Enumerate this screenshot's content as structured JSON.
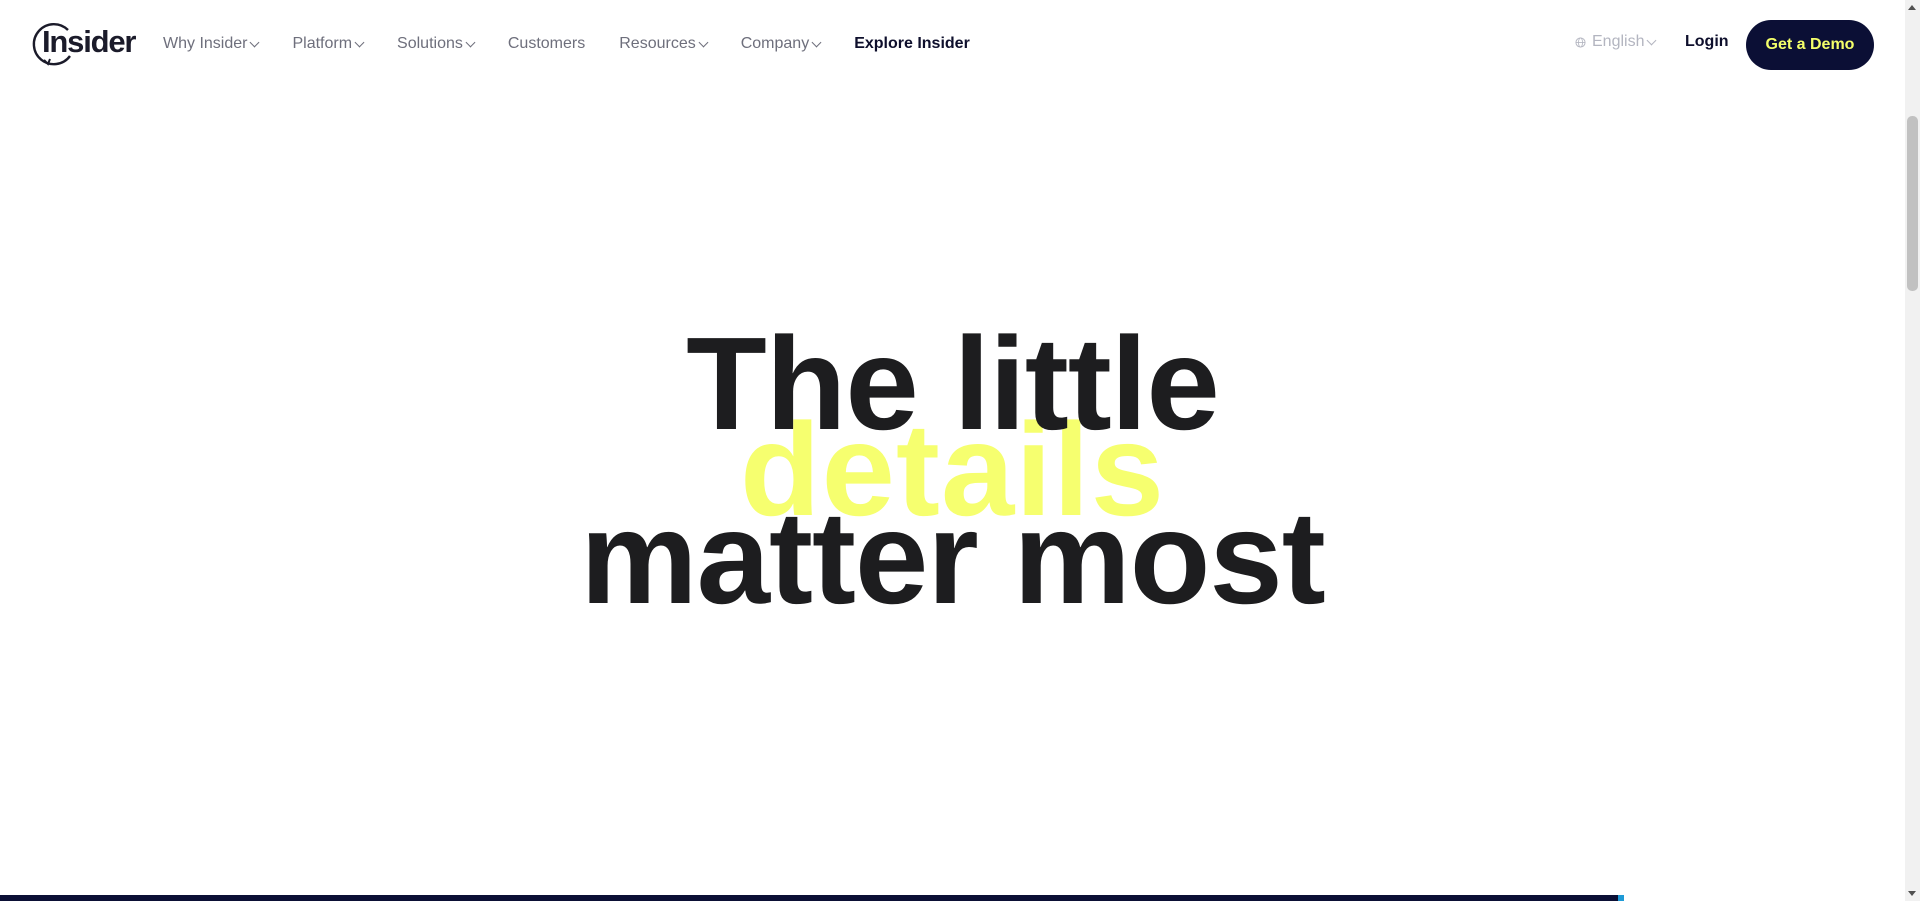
{
  "header": {
    "logo_text": "Insider",
    "nav": [
      {
        "label": "Why Insider",
        "has_dropdown": true
      },
      {
        "label": "Platform",
        "has_dropdown": true
      },
      {
        "label": "Solutions",
        "has_dropdown": true
      },
      {
        "label": "Customers",
        "has_dropdown": false
      },
      {
        "label": "Resources",
        "has_dropdown": true
      },
      {
        "label": "Company",
        "has_dropdown": true
      },
      {
        "label": "Explore Insider",
        "has_dropdown": false
      }
    ],
    "language": "English",
    "login_label": "Login",
    "demo_label": "Get a Demo"
  },
  "hero": {
    "line1": "The little",
    "accent": "details",
    "line2": "matter most"
  },
  "colors": {
    "brand_dark": "#0b0f35",
    "accent_yellow": "#f6ff6f",
    "demo_text": "#f4ff6a",
    "nav_text": "#6e6f7c",
    "headline": "#1d1d1f"
  },
  "icons": {
    "language": "globe-icon",
    "dropdown": "chevron-down-icon"
  }
}
